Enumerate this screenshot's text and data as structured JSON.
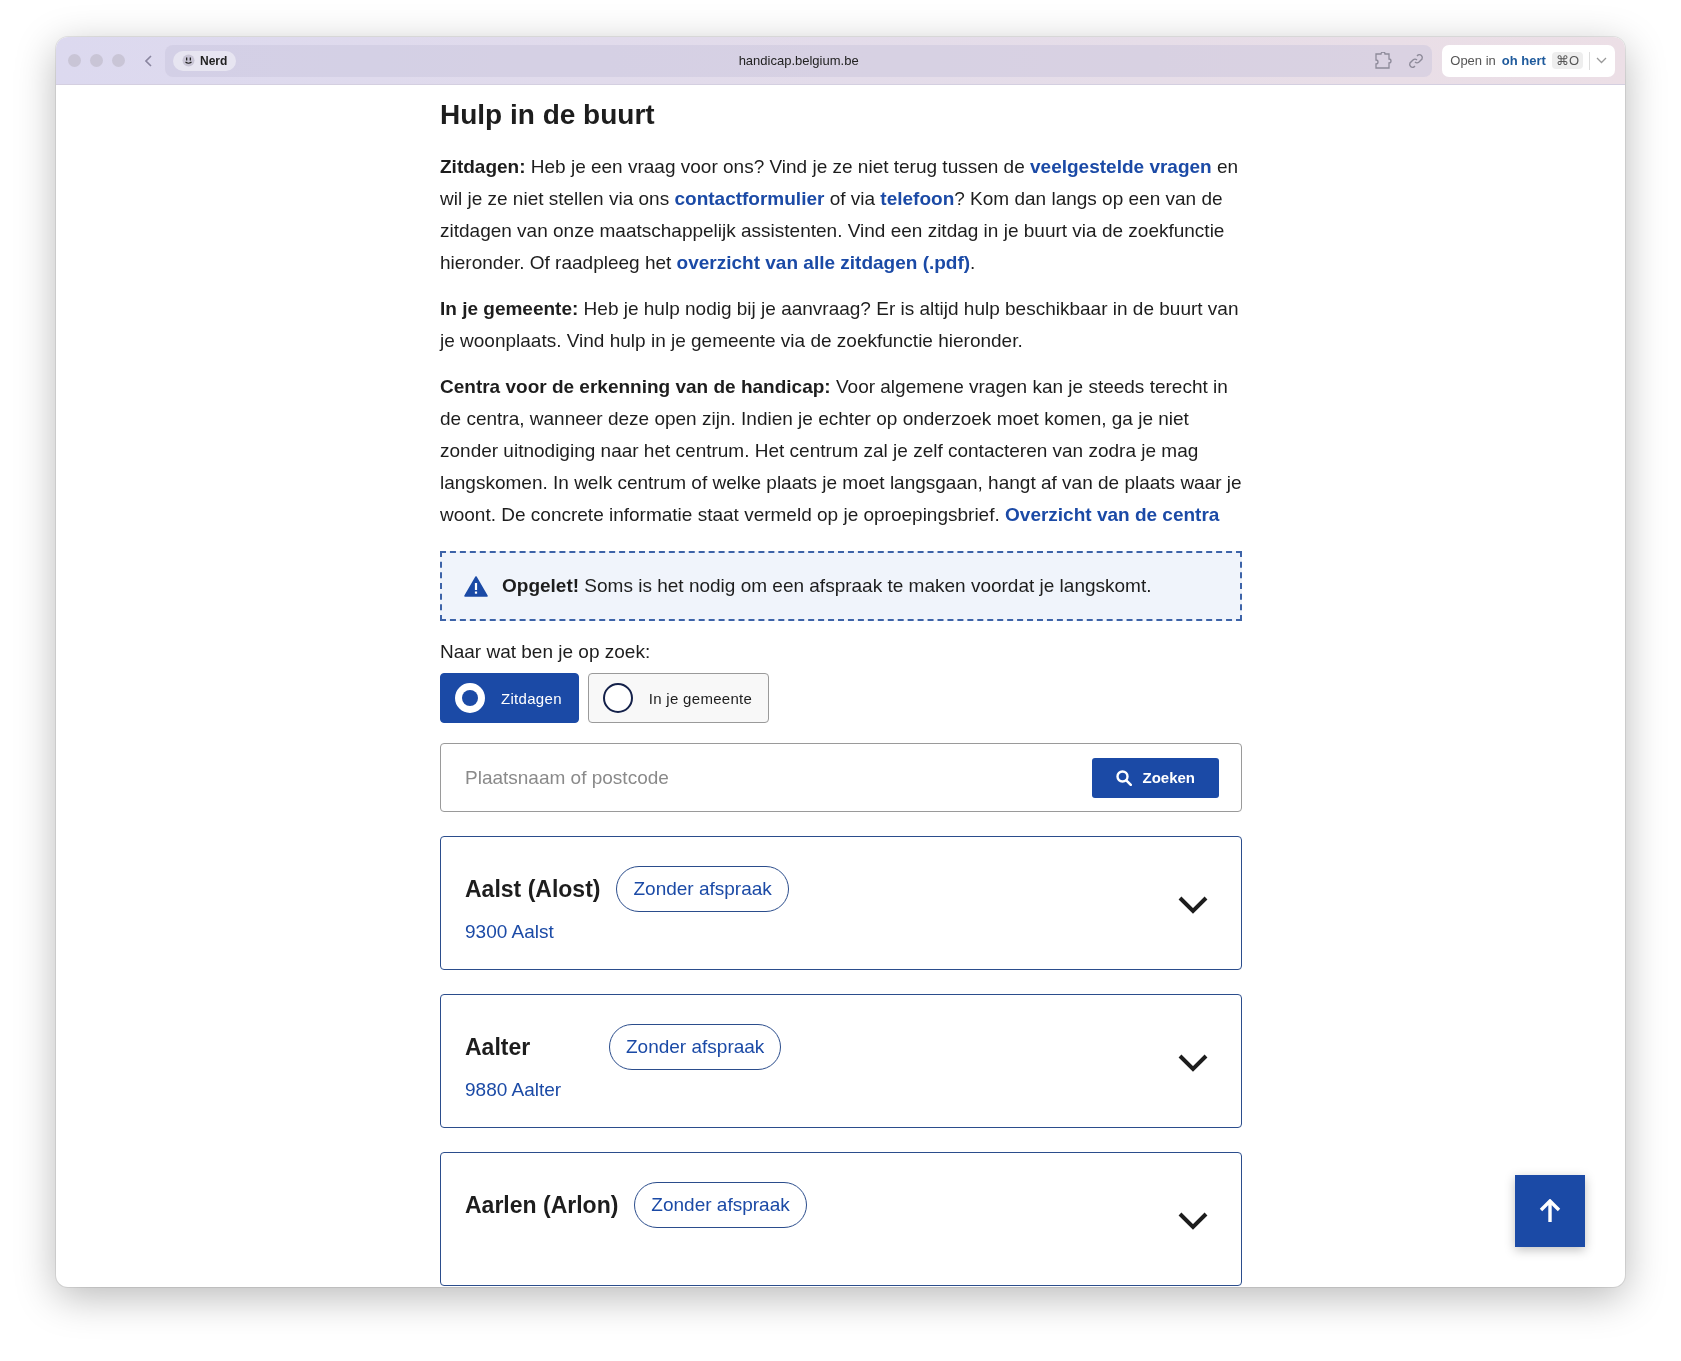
{
  "browser": {
    "profile": "Nerd",
    "url": "handicap.belgium.be",
    "open_in": {
      "label": "Open in",
      "app": "oh hert",
      "shortcut": "⌘O"
    }
  },
  "page": {
    "title": "Hulp in de buurt",
    "paragraphs": [
      [
        {
          "kind": "bold",
          "text": "Zitdagen:"
        },
        {
          "kind": "text",
          "text": " Heb je een vraag voor ons? Vind je ze niet terug tussen de "
        },
        {
          "kind": "link",
          "text": "veelgestelde vragen"
        },
        {
          "kind": "text",
          "text": " en wil je ze niet stellen via ons "
        },
        {
          "kind": "link",
          "text": "contactformulier"
        },
        {
          "kind": "text",
          "text": " of via "
        },
        {
          "kind": "link",
          "text": "telefoon"
        },
        {
          "kind": "text",
          "text": "? Kom dan langs op een van de zitdagen van onze maatschappelijk assistenten. Vind een zitdag in je buurt via de zoekfunctie hieronder. Of raadpleeg het "
        },
        {
          "kind": "link",
          "text": "overzicht van alle zitdagen (.pdf)"
        },
        {
          "kind": "text",
          "text": "."
        }
      ],
      [
        {
          "kind": "bold",
          "text": "In je gemeente:"
        },
        {
          "kind": "text",
          "text": " Heb je hulp nodig bij je aanvraag? Er is altijd hulp beschikbaar in de buurt van je woonplaats. Vind hulp in je gemeente via de zoekfunctie hieronder."
        }
      ],
      [
        {
          "kind": "bold",
          "text": "Centra voor de erkenning van de handicap:"
        },
        {
          "kind": "text",
          "text": " Voor algemene vragen kan je steeds terecht in de centra, wanneer deze open zijn. Indien je echter op onderzoek moet komen, ga je niet zonder uitnodiging naar het centrum. Het centrum zal je zelf contacteren van zodra je mag langskomen. In welk centrum of welke plaats je moet langsgaan, hangt af van de plaats waar je woont. De concrete informatie staat vermeld op je oproepingsbrief. "
        },
        {
          "kind": "link",
          "text": "Overzicht van de centra"
        }
      ]
    ],
    "notice": {
      "label": "Opgelet!",
      "text": "Soms is het nodig om een afspraak te maken voordat je langskomt."
    },
    "search": {
      "label": "Naar wat ben je op zoek:",
      "options": [
        {
          "label": "Zitdagen",
          "selected": true
        },
        {
          "label": "In je gemeente",
          "selected": false
        }
      ],
      "placeholder": "Plaatsnaam of postcode",
      "button": "Zoeken"
    },
    "results": [
      {
        "name": "Aalst (Alost)",
        "badge": "Zonder afspraak",
        "address": "9300 Aalst"
      },
      {
        "name": "Aalter",
        "badge": "Zonder afspraak",
        "address": "9880 Aalter"
      },
      {
        "name": "Aarlen (Arlon)",
        "badge": "Zonder afspraak"
      }
    ]
  }
}
